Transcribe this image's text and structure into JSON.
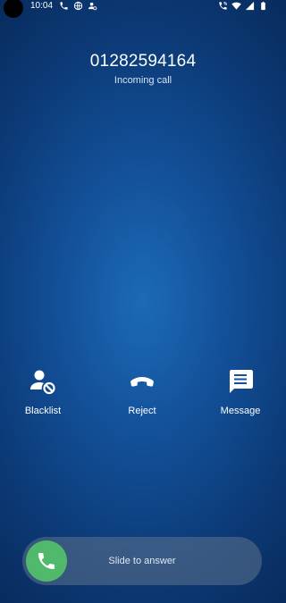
{
  "status_bar": {
    "time": "10:04",
    "left_icons": [
      "phone-icon",
      "vpn-globe-icon",
      "account-sync-icon"
    ],
    "right_icons": [
      "wifi-calling-icon",
      "wifi-icon",
      "cellular-signal-icon",
      "battery-icon"
    ]
  },
  "call": {
    "number": "01282594164",
    "state": "Incoming call"
  },
  "actions": [
    {
      "icon": "block-contact-icon",
      "label": "Blacklist"
    },
    {
      "icon": "hang-up-icon",
      "label": "Reject"
    },
    {
      "icon": "message-icon",
      "label": "Message"
    }
  ],
  "answer_slider": {
    "label": "Slide to answer",
    "icon": "phone-answer-icon"
  },
  "colors": {
    "background": "#13519a",
    "answer_button": "#51b96b",
    "text": "#ffffff"
  }
}
